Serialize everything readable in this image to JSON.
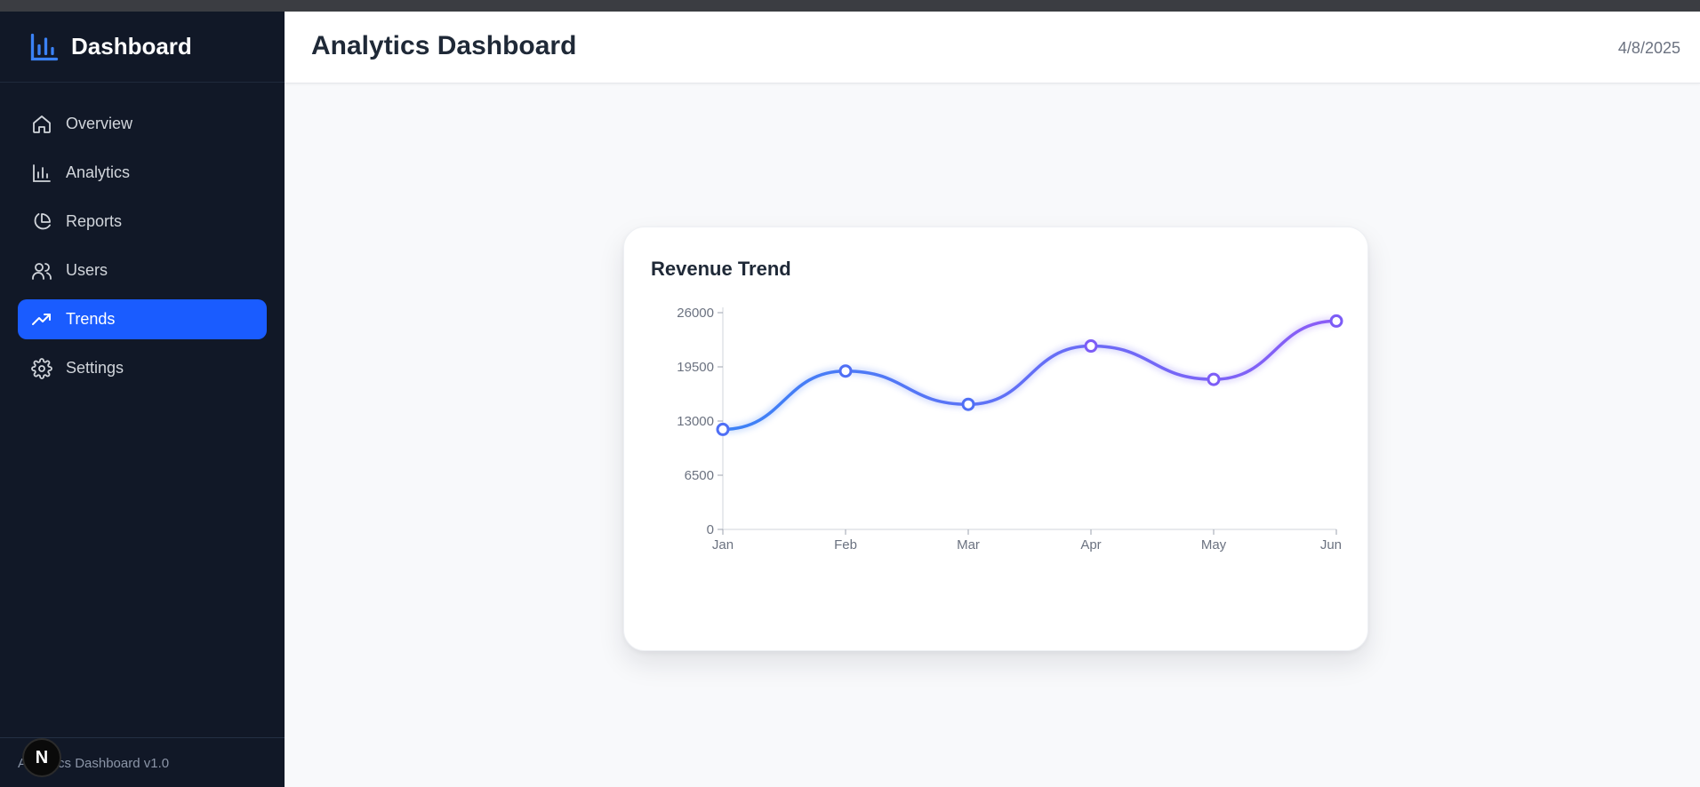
{
  "app": {
    "brand_title": "Dashboard",
    "footer": "Analytics Dashboard v1.0",
    "badge_letter": "N"
  },
  "sidebar": {
    "items": [
      {
        "label": "Overview",
        "icon": "home-icon",
        "active": false
      },
      {
        "label": "Analytics",
        "icon": "bar-chart-icon",
        "active": false
      },
      {
        "label": "Reports",
        "icon": "pie-chart-icon",
        "active": false
      },
      {
        "label": "Users",
        "icon": "users-icon",
        "active": false
      },
      {
        "label": "Trends",
        "icon": "trending-up-icon",
        "active": true
      },
      {
        "label": "Settings",
        "icon": "gear-icon",
        "active": false
      }
    ]
  },
  "header": {
    "title": "Analytics Dashboard",
    "date": "4/8/2025"
  },
  "colors": {
    "sidebar_bg": "#111827",
    "accent": "#1a5cff",
    "line_start": "#3b82f6",
    "line_end": "#8b5cf6"
  },
  "chart_data": {
    "type": "line",
    "title": "Revenue Trend",
    "categories": [
      "Jan",
      "Feb",
      "Mar",
      "Apr",
      "May",
      "Jun"
    ],
    "values": [
      12000,
      19000,
      15000,
      22000,
      18000,
      25000
    ],
    "ylim": [
      0,
      26000
    ],
    "yticks": [
      0,
      6500,
      13000,
      19500,
      26000
    ],
    "grid": false,
    "legend": "none"
  }
}
